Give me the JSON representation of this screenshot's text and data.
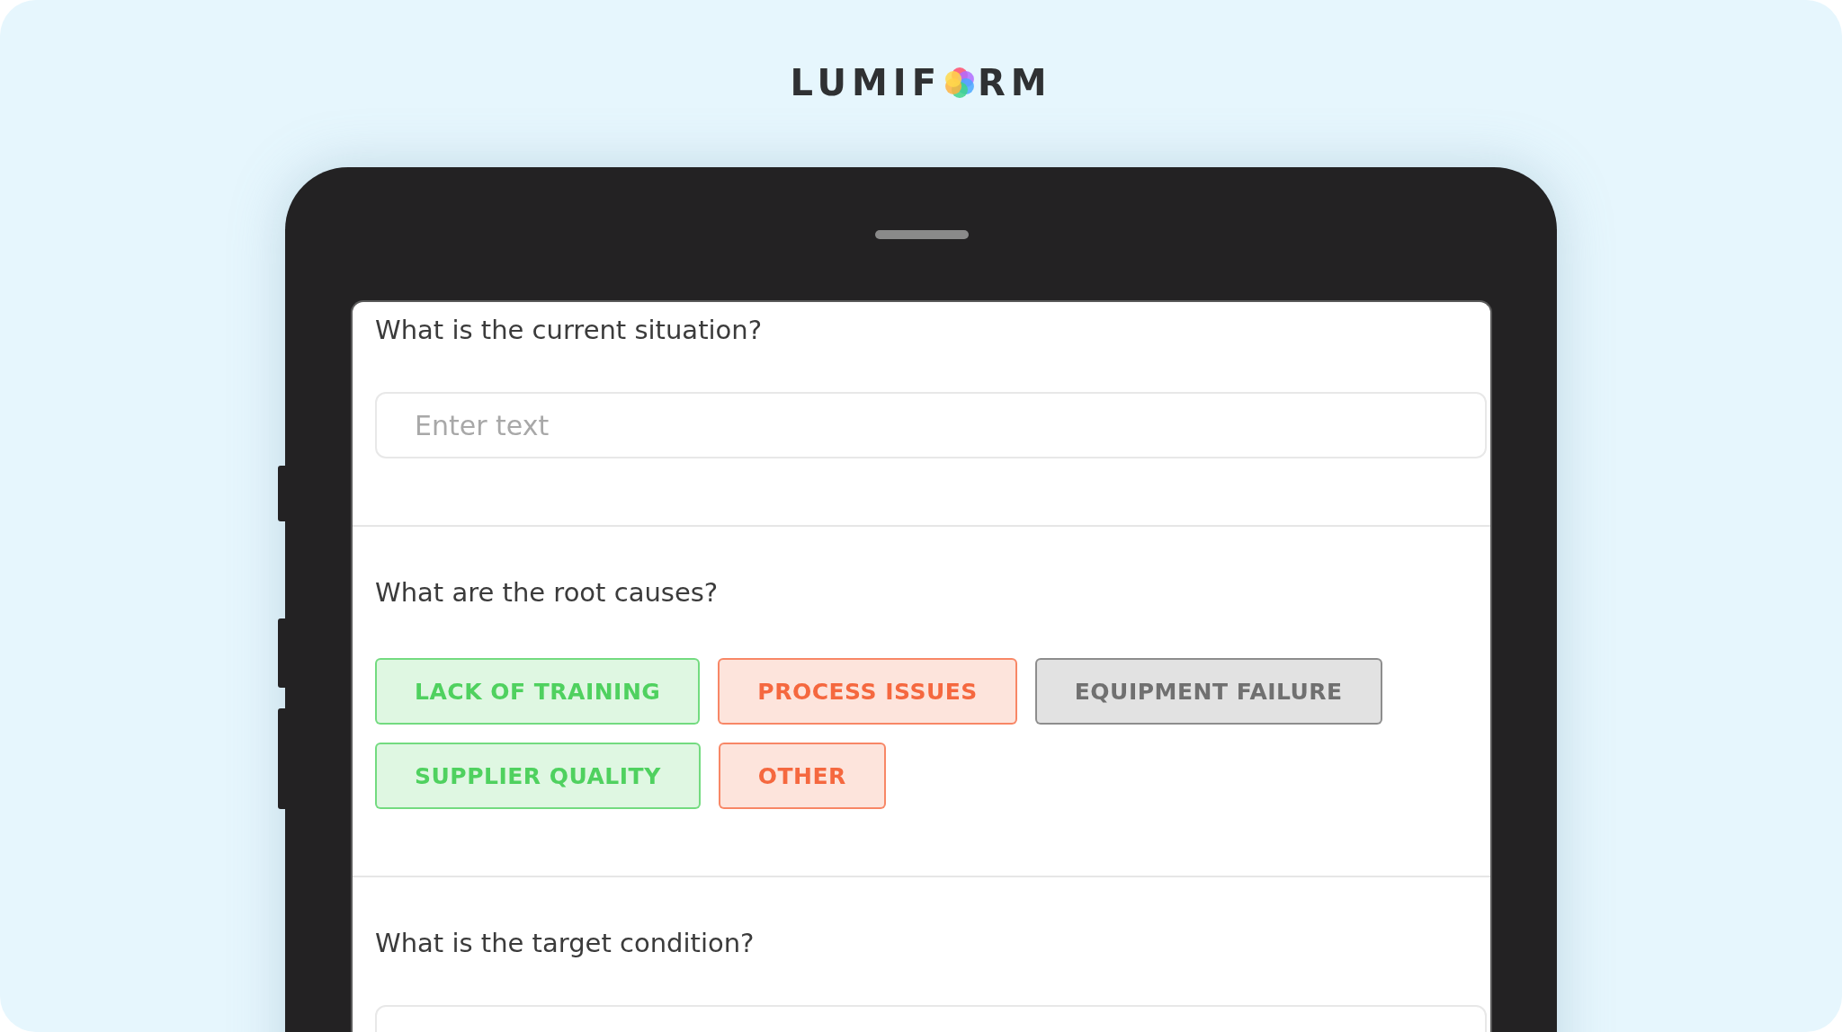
{
  "logo": {
    "before": "LUMIF",
    "after": "RM"
  },
  "sections": [
    {
      "kind": "text",
      "question": "What is the current situation?",
      "placeholder": "Enter text"
    },
    {
      "kind": "choices",
      "question": "What are the root causes?",
      "options": [
        {
          "label": "LACK OF TRAINING",
          "color": "#4fd15f"
        },
        {
          "label": "PROCESS ISSUES",
          "color": "#f5683f"
        },
        {
          "label": "EQUIPMENT FAILURE",
          "color": "#707070"
        },
        {
          "label": "SUPPLIER QUALITY",
          "color": "#4fd15f"
        },
        {
          "label": "OTHER",
          "color": "#f5683f"
        }
      ]
    },
    {
      "kind": "text",
      "question": "What is the target condition?"
    }
  ]
}
